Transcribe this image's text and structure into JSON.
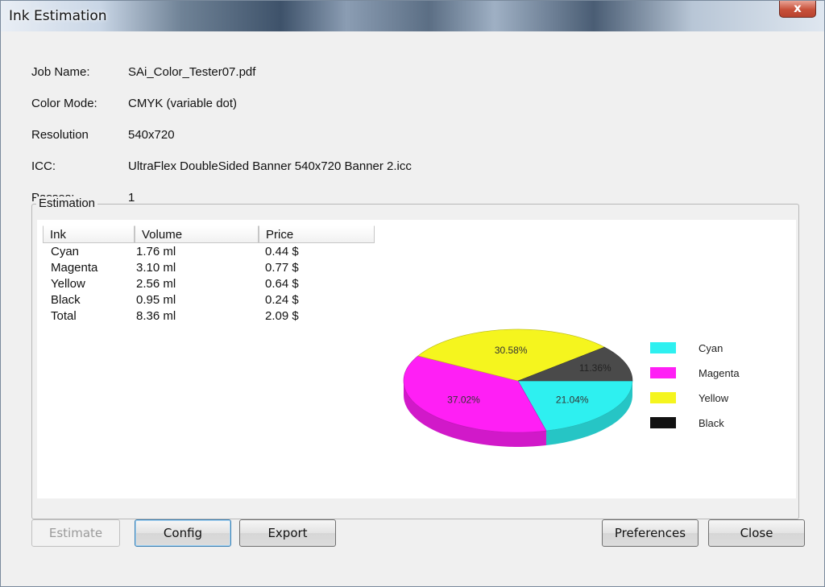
{
  "window": {
    "title": "Ink Estimation",
    "close_label": "x"
  },
  "info": {
    "job_name": {
      "label": "Job Name:",
      "value": "SAi_Color_Tester07.pdf"
    },
    "color_mode": {
      "label": "Color Mode:",
      "value": "CMYK (variable dot)"
    },
    "resolution": {
      "label": "Resolution",
      "value": "540x720"
    },
    "icc": {
      "label": "ICC:",
      "value": "UltraFlex DoubleSided Banner 540x720 Banner 2.icc"
    },
    "passes": {
      "label": "Passes:",
      "value": "1"
    }
  },
  "estimation": {
    "group_title": "Estimation",
    "columns": [
      "Ink",
      "Volume",
      "Price"
    ],
    "rows": [
      {
        "ink": "Cyan",
        "volume": "1.76 ml",
        "price": "0.44 $"
      },
      {
        "ink": "Magenta",
        "volume": "3.10 ml",
        "price": "0.77 $"
      },
      {
        "ink": "Yellow",
        "volume": "2.56 ml",
        "price": "0.64 $"
      },
      {
        "ink": "Black",
        "volume": "0.95 ml",
        "price": "0.24 $"
      },
      {
        "ink": "Total",
        "volume": "8.36 ml",
        "price": "2.09 $"
      }
    ]
  },
  "chart_data": {
    "type": "pie",
    "categories": [
      "Cyan",
      "Magenta",
      "Yellow",
      "Black"
    ],
    "values": [
      21.04,
      37.02,
      30.58,
      11.36
    ],
    "labels": [
      "21.04%",
      "37.02%",
      "30.58%",
      "11.36%"
    ],
    "colors": [
      "#2ef0f0",
      "#ff1ff5",
      "#f5f51e",
      "#4a4a4a"
    ],
    "legend": "right"
  },
  "buttons": {
    "estimate": "Estimate",
    "config": "Config",
    "export": "Export",
    "preferences": "Preferences",
    "close": "Close"
  }
}
